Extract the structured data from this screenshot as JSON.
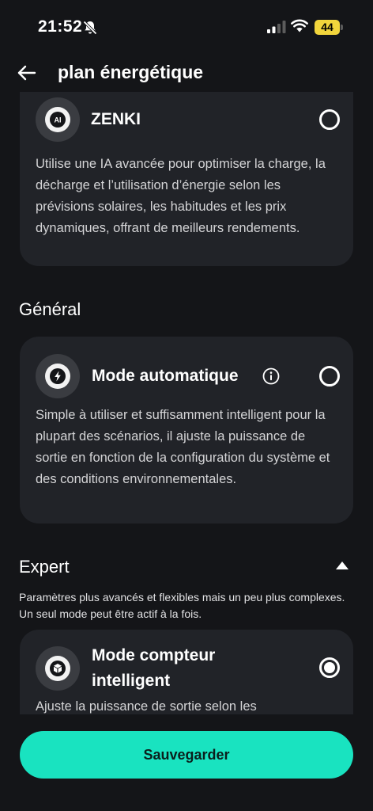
{
  "status": {
    "time": "21:52",
    "battery": "44"
  },
  "header": {
    "title": "plan énergétique"
  },
  "zenki": {
    "icon_label": "AI",
    "title": "ZENKI",
    "description": "Utilise une IA avancée pour optimiser la charge, la décharge et l’utilisation d’énergie selon les prévisions solaires, les habitudes et les prix dynamiques, offrant de meilleurs rendements."
  },
  "general": {
    "section_title": "Général",
    "auto_mode": {
      "title": "Mode automatique",
      "description": "Simple à utiliser et suffisamment intelligent pour la plupart des scénarios, il ajuste la puissance de sortie en fonction de la configuration du système et des conditions environnementales."
    }
  },
  "expert": {
    "section_title": "Expert",
    "description": "Paramètres plus avancés et flexibles mais un peu plus complexes. Un seul mode peut être actif à la fois.",
    "smart_meter": {
      "title": "Mode compteur intelligent",
      "description": "Ajuste la puissance de sortie selon les"
    }
  },
  "footer": {
    "save_label": "Sauvegarder"
  },
  "colors": {
    "accent": "#19e3c0",
    "background": "#141518",
    "card": "#212328"
  },
  "icons": [
    "bell-slash-icon",
    "signal-icon",
    "wifi-icon",
    "back-arrow-icon",
    "ai-chip-icon",
    "lightning-icon",
    "info-icon",
    "cube-icon",
    "chevron-up-icon"
  ]
}
